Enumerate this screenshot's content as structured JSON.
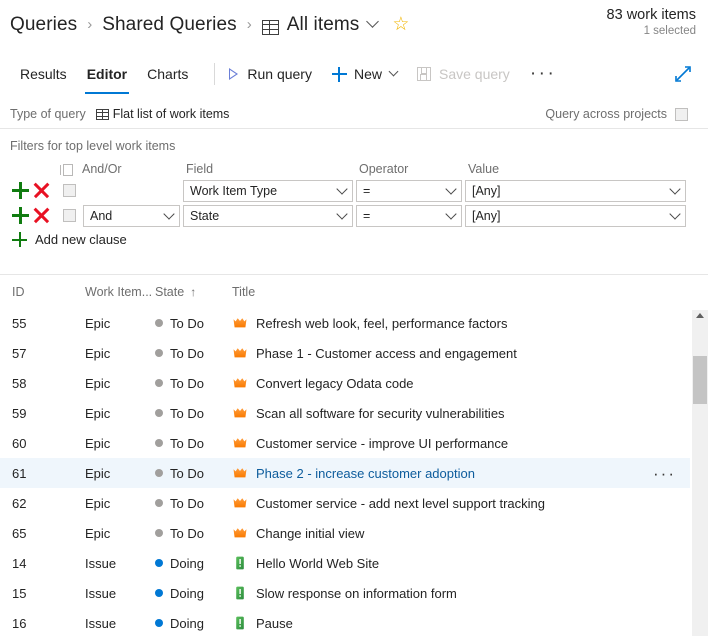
{
  "breadcrumb": {
    "root": "Queries",
    "folder": "Shared Queries",
    "query": "All items",
    "separator": "›",
    "grid_icon": "grid-icon",
    "chevron_icon": "chevron-down-icon",
    "favorite_icon": "☆"
  },
  "header": {
    "work_items_count": "83 work items",
    "selected_count": "1 selected"
  },
  "tabs": [
    {
      "label": "Results",
      "active": false
    },
    {
      "label": "Editor",
      "active": true
    },
    {
      "label": "Charts",
      "active": false
    }
  ],
  "toolbar": {
    "run_query": "Run query",
    "new": "New",
    "save_query": "Save query",
    "save_query_disabled": true,
    "more_label": "···",
    "expand_label": "expand-icon"
  },
  "query_type": {
    "label": "Type of query",
    "value": "Flat list of work items",
    "across_projects_label": "Query across projects",
    "across_projects_checked": false
  },
  "filters": {
    "section_title": "Filters for top level work items",
    "columns": {
      "andor": "And/Or",
      "field": "Field",
      "operator": "Operator",
      "value": "Value"
    },
    "rows": [
      {
        "andor": "",
        "field": "Work Item Type",
        "operator": "=",
        "value": "[Any]"
      },
      {
        "andor": "And",
        "field": "State",
        "operator": "=",
        "value": "[Any]"
      }
    ],
    "add_clause": "Add new clause"
  },
  "grid": {
    "columns": {
      "id": "ID",
      "work_item_type": "Work Item...",
      "state": "State",
      "title": "Title"
    },
    "sort_indicator": "↑",
    "row_more_label": "···",
    "rows": [
      {
        "id": "55",
        "type": "Epic",
        "state": "To Do",
        "state_color": "#a19f9d",
        "title": "Refresh web look, feel, performance factors",
        "icon": "epic-crown-icon",
        "selected": false
      },
      {
        "id": "57",
        "type": "Epic",
        "state": "To Do",
        "state_color": "#a19f9d",
        "title": "Phase 1 - Customer access and engagement",
        "icon": "epic-crown-icon",
        "selected": false
      },
      {
        "id": "58",
        "type": "Epic",
        "state": "To Do",
        "state_color": "#a19f9d",
        "title": "Convert legacy Odata code",
        "icon": "epic-crown-icon",
        "selected": false
      },
      {
        "id": "59",
        "type": "Epic",
        "state": "To Do",
        "state_color": "#a19f9d",
        "title": "Scan all software for security vulnerabilities",
        "icon": "epic-crown-icon",
        "selected": false
      },
      {
        "id": "60",
        "type": "Epic",
        "state": "To Do",
        "state_color": "#a19f9d",
        "title": "Customer service - improve UI performance",
        "icon": "epic-crown-icon",
        "selected": false
      },
      {
        "id": "61",
        "type": "Epic",
        "state": "To Do",
        "state_color": "#a19f9d",
        "title": "Phase 2 - increase customer adoption",
        "icon": "epic-crown-icon",
        "selected": true
      },
      {
        "id": "62",
        "type": "Epic",
        "state": "To Do",
        "state_color": "#a19f9d",
        "title": "Customer service - add next level support tracking",
        "icon": "epic-crown-icon",
        "selected": false
      },
      {
        "id": "65",
        "type": "Epic",
        "state": "To Do",
        "state_color": "#a19f9d",
        "title": "Change initial view",
        "icon": "epic-crown-icon",
        "selected": false
      },
      {
        "id": "14",
        "type": "Issue",
        "state": "Doing",
        "state_color": "#0078d4",
        "title": "Hello World Web Site",
        "icon": "issue-icon",
        "selected": false
      },
      {
        "id": "15",
        "type": "Issue",
        "state": "Doing",
        "state_color": "#0078d4",
        "title": "Slow response on information form",
        "icon": "issue-icon",
        "selected": false
      },
      {
        "id": "16",
        "type": "Issue",
        "state": "Doing",
        "state_color": "#0078d4",
        "title": "Pause",
        "icon": "issue-icon",
        "selected": false
      }
    ]
  },
  "colors": {
    "accent": "#0078d4",
    "epic_icon": "#ff8c00",
    "issue_icon": "#339947",
    "add_green": "#107c10",
    "delete_red": "#e81123",
    "selected_row_bg": "#eff6fc"
  }
}
